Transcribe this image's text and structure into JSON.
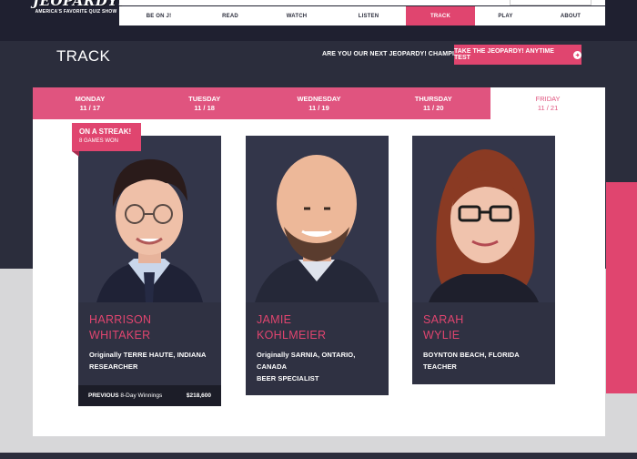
{
  "site": {
    "logo_title": "JEOPARDY!",
    "logo_tagline": "AMERICA'S FAVORITE QUIZ SHOW"
  },
  "nav": {
    "items": [
      {
        "label": "BE ON J!",
        "active": false
      },
      {
        "label": "READ",
        "active": false
      },
      {
        "label": "WATCH",
        "active": false
      },
      {
        "label": "LISTEN",
        "active": false
      },
      {
        "label": "TRACK",
        "active": true
      },
      {
        "label": "PLAY",
        "active": false
      },
      {
        "label": "ABOUT",
        "active": false
      }
    ]
  },
  "page": {
    "title": "TRACK",
    "cta_question": "ARE YOU OUR NEXT JEOPARDY! CHAMPION?",
    "cta_button": "TAKE THE JEOPARDY! ANYTIME TEST",
    "cta_icon": "arrow-right-circle-icon"
  },
  "days": [
    {
      "day": "MONDAY",
      "date": "11 / 17",
      "active": false
    },
    {
      "day": "TUESDAY",
      "date": "11 / 18",
      "active": false
    },
    {
      "day": "WEDNESDAY",
      "date": "11 / 19",
      "active": false
    },
    {
      "day": "THURSDAY",
      "date": "11 / 20",
      "active": false
    },
    {
      "day": "FRIDAY",
      "date": "11 / 21",
      "active": true
    }
  ],
  "contestants": [
    {
      "first": "HARRISON",
      "last": "WHITAKER",
      "origin": "Originally TERRE HAUTE, INDIANA",
      "occupation": "RESEARCHER",
      "streak_label": "ON A STREAK!",
      "streak_games": "8 GAMES WON",
      "previous_label": "PREVIOUS",
      "previous_detail": "8-Day Winnings",
      "previous_amount": "$218,600"
    },
    {
      "first": "JAMIE",
      "last": "KOHLMEIER",
      "origin_line1": "Originally SARNIA, ONTARIO,",
      "origin_line2": "CANADA",
      "occupation": "BEER SPECIALIST"
    },
    {
      "first": "SARAH",
      "last": "WYLIE",
      "origin": "BOYNTON BEACH, FLORIDA",
      "occupation": "TEACHER"
    }
  ],
  "colors": {
    "accent": "#e0456f",
    "dark": "#2b2d3c",
    "card": "#2f3142"
  }
}
